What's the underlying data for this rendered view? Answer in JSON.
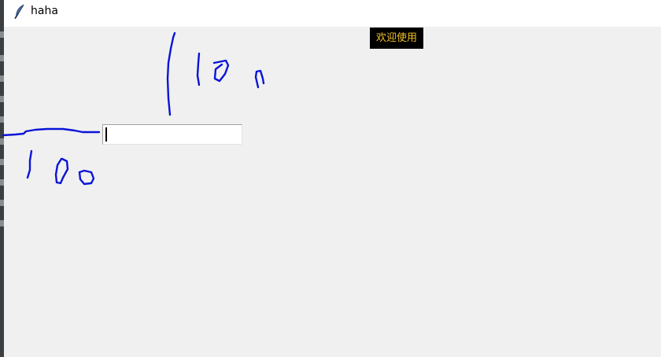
{
  "window": {
    "title": "haha",
    "icon": "feather-icon"
  },
  "label": {
    "text": "欢迎使用",
    "background": "#000000",
    "foreground": "#f0c020"
  },
  "entry": {
    "value": ""
  },
  "colors": {
    "ink": "#0a14d8",
    "canvas": "#f0f0f0"
  }
}
